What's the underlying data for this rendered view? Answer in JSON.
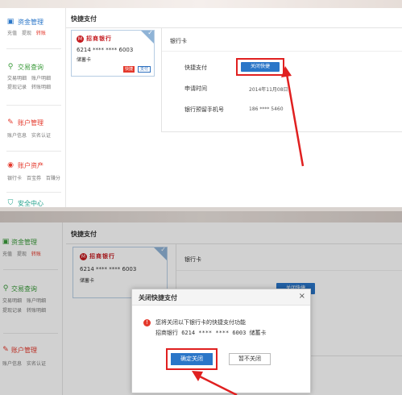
{
  "sidebar": {
    "sections": [
      {
        "icon": "wallet-icon",
        "title": "资金管理",
        "links": [
          "充值",
          "提现",
          "转账"
        ],
        "highlight": 2
      },
      {
        "icon": "search-icon",
        "title": "交易查询",
        "links": [
          "交易明细",
          "账户明细",
          "提现记录",
          "转账明细"
        ],
        "highlight": -1
      },
      {
        "icon": "edit-icon",
        "title": "账户管理",
        "links": [
          "账户信息",
          "实名认证"
        ],
        "highlight": -1
      },
      {
        "icon": "asset-icon",
        "title": "账户资产",
        "links": [
          "银行卡",
          "百宝券",
          "百赚分"
        ],
        "highlight": -1
      },
      {
        "icon": "shield-icon",
        "title": "安全中心",
        "links": [],
        "highlight": -1
      }
    ]
  },
  "content": {
    "title": "快捷支付"
  },
  "card": {
    "bank_name": "招商银行",
    "number": "6214 **** **** 6003",
    "type": "储蓄卡",
    "tag_fast": "快捷",
    "tag_pay": "支付"
  },
  "detail": {
    "heading": "银行卡",
    "rows": {
      "quick_pay_label": "快捷支付",
      "apply_time_label": "申请时间",
      "apply_time_value": "2014年11月08日",
      "phone_label": "银行预留手机号",
      "phone_value": "186 **** 5460"
    },
    "close_button": "关闭快捷"
  },
  "dialog": {
    "title": "关闭快捷支付",
    "close": "×",
    "message": "您将关闭以下银行卡的快捷支付功能",
    "card_line": "招商银行 6214 **** **** 6003 储蓄卡",
    "confirm": "确定关闭",
    "cancel": "暂不关闭"
  },
  "colors": {
    "accent_blue": "#2a76c8",
    "annotation_red": "#e02020",
    "bank_red": "#c41a1f"
  }
}
